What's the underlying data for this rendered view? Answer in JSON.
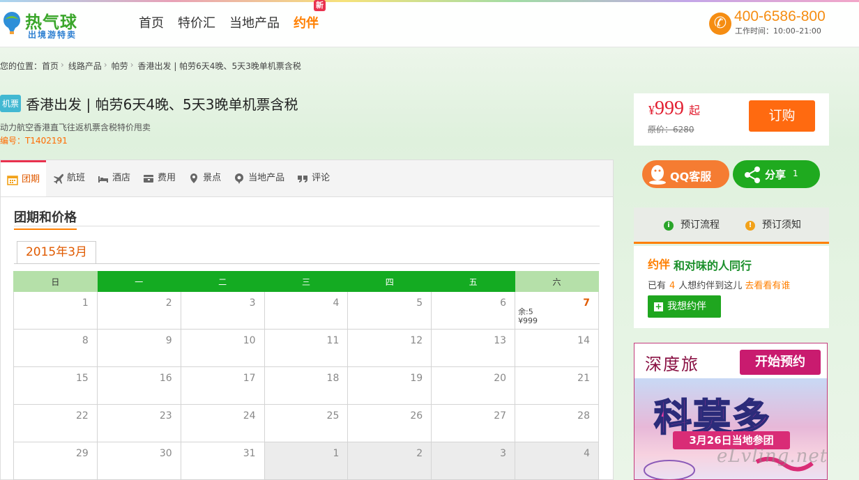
{
  "header": {
    "logo_title": "热气球",
    "logo_sub": "出境游特卖",
    "nav": [
      "首页",
      "特价汇",
      "当地产品"
    ],
    "nav_special": "约伴",
    "new_badge": "新",
    "phone": "400-6586-800",
    "hours": "工作时间：10:00–21:00"
  },
  "breadcrumb": {
    "prefix": "您的位置：",
    "items": [
      "首页",
      "线路产品",
      "帕劳",
      "香港出发 | 帕劳6天4晚、5天3晚单机票含税"
    ],
    "separator": "›"
  },
  "product": {
    "tag": "机票",
    "title": "香港出发 | 帕劳6天4晚、5天3晚单机票含税",
    "subtitle": "动力航空香港直飞往返机票含税特价甩卖",
    "code": "编号：T1402191"
  },
  "tabs": [
    "团期",
    "航班",
    "酒店",
    "费用",
    "景点",
    "当地产品",
    "评论"
  ],
  "calendar": {
    "section_title": "团期和价格",
    "month": "2015年3月",
    "weekdays": [
      "日",
      "一",
      "二",
      "三",
      "四",
      "五",
      "六"
    ],
    "weeks": [
      [
        {
          "d": "1"
        },
        {
          "d": "2"
        },
        {
          "d": "3"
        },
        {
          "d": "4"
        },
        {
          "d": "5"
        },
        {
          "d": "6"
        },
        {
          "d": "7",
          "hl": true,
          "left": "余:5",
          "price": "¥999"
        }
      ],
      [
        {
          "d": "8"
        },
        {
          "d": "9"
        },
        {
          "d": "10"
        },
        {
          "d": "11"
        },
        {
          "d": "12"
        },
        {
          "d": "13"
        },
        {
          "d": "14"
        }
      ],
      [
        {
          "d": "15"
        },
        {
          "d": "16"
        },
        {
          "d": "17"
        },
        {
          "d": "18"
        },
        {
          "d": "19"
        },
        {
          "d": "20"
        },
        {
          "d": "21"
        }
      ],
      [
        {
          "d": "22"
        },
        {
          "d": "23"
        },
        {
          "d": "24"
        },
        {
          "d": "25"
        },
        {
          "d": "26"
        },
        {
          "d": "27"
        },
        {
          "d": "28"
        }
      ],
      [
        {
          "d": "29"
        },
        {
          "d": "30"
        },
        {
          "d": "31"
        },
        {
          "d": "1",
          "other": true
        },
        {
          "d": "2",
          "other": true
        },
        {
          "d": "3",
          "other": true
        },
        {
          "d": "4",
          "other": true
        }
      ]
    ]
  },
  "price_box": {
    "currency": "¥",
    "price": "999",
    "suffix": "起",
    "original": "原价：6280",
    "book": "订购"
  },
  "service": {
    "qq": "QQ客服",
    "share": "分享",
    "share_count": "1"
  },
  "flow": {
    "process": "预订流程",
    "notice": "预订须知"
  },
  "companion": {
    "logo": "约伴",
    "title": "和对味的人同行",
    "text_pre": "已有",
    "count": "4",
    "text_post": "人想约伴到这儿",
    "link": "去看看有谁",
    "button": "我想约伴"
  },
  "ad": {
    "brand": "深度旅",
    "cta": "开始预约",
    "title": "科莫多",
    "band": "3月26日当地参团"
  },
  "watermark": "eLvling.net",
  "colors": {
    "green": "#14ab22",
    "orange": "#ff6a10",
    "red": "#e21e30",
    "pink": "#c91b6f"
  }
}
